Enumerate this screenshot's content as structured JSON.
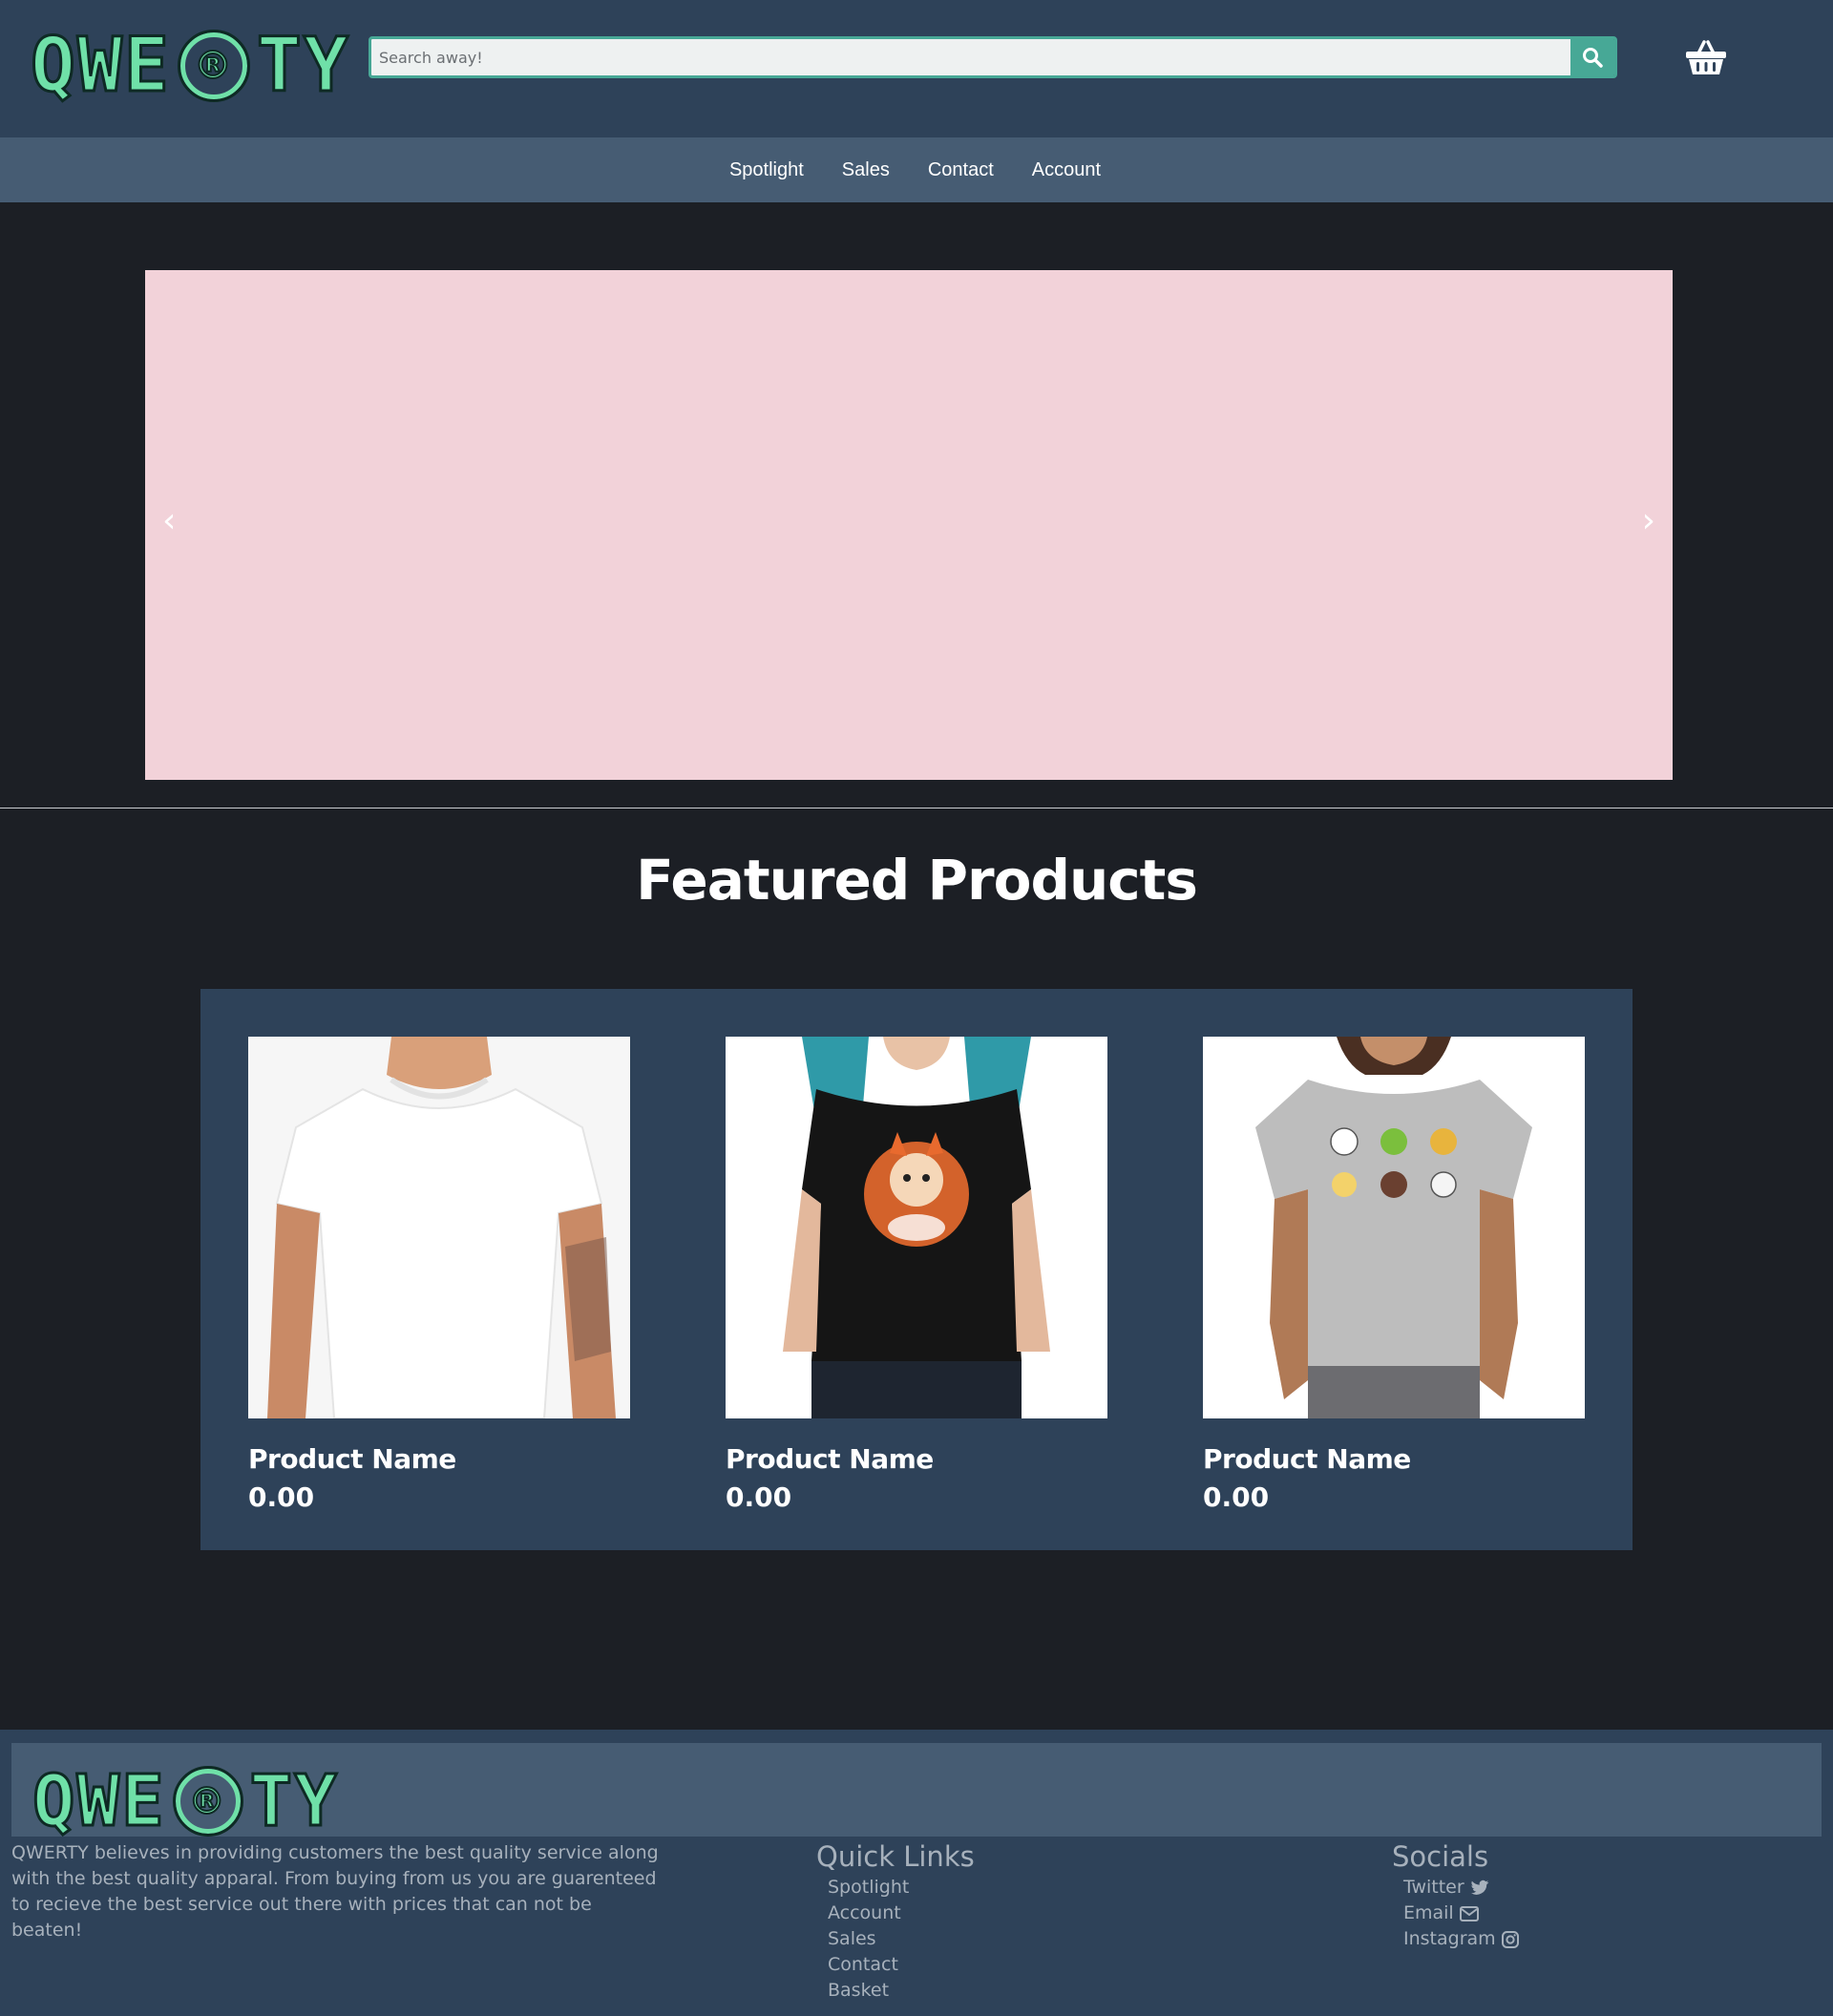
{
  "brand": {
    "logo_left": "QWE",
    "logo_mark": "®",
    "logo_right": "TY"
  },
  "search": {
    "placeholder": "Search away!"
  },
  "icons": {
    "search": "search-icon",
    "basket": "basket-icon",
    "twitter": "twitter-icon",
    "email": "envelope-icon",
    "instagram": "instagram-icon"
  },
  "nav": {
    "items": [
      {
        "label": "Spotlight"
      },
      {
        "label": "Sales"
      },
      {
        "label": "Contact"
      },
      {
        "label": "Account"
      }
    ]
  },
  "carousel": {
    "prev": "‹",
    "next": "›"
  },
  "featured": {
    "title": "Featured Products",
    "products": [
      {
        "name": "Product Name",
        "price": "0.00"
      },
      {
        "name": "Product Name",
        "price": "0.00"
      },
      {
        "name": "Product Name",
        "price": "0.00"
      }
    ]
  },
  "footer": {
    "about": "QWERTY believes in providing customers the best quality service along with the best quality apparal. From buying from us you are guarenteed to recieve the best service out there with prices that can not be beaten!",
    "quick_links": {
      "title": "Quick Links",
      "items": [
        "Spotlight",
        "Account",
        "Sales",
        "Contact",
        "Basket"
      ]
    },
    "socials": {
      "title": "Socials",
      "items": [
        "Twitter",
        "Email",
        "Instagram"
      ]
    }
  },
  "colors": {
    "header_bg": "#2e4259",
    "nav_bg": "#465c73",
    "page_bg": "#1c1f25",
    "accent": "#47a896",
    "logo_green": "#6fe0a8",
    "carousel_bg": "#f2d2d9",
    "footer_text": "#a7b1bc"
  }
}
